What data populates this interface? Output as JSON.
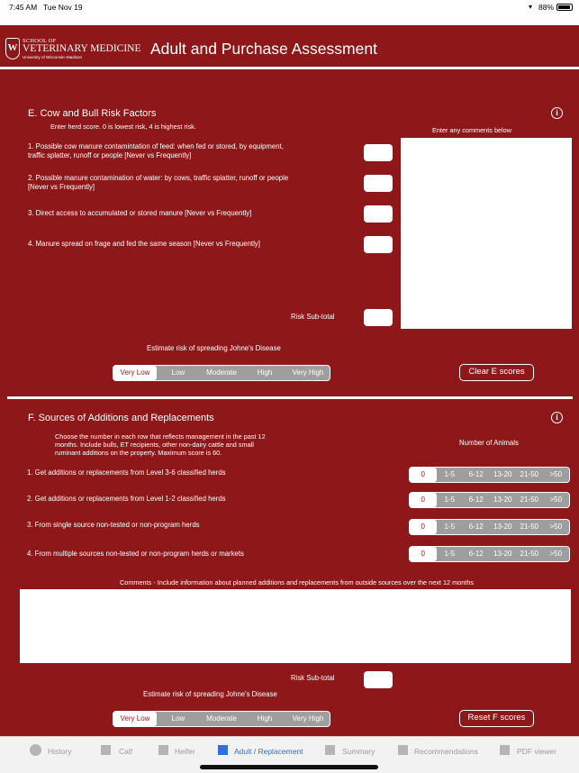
{
  "status_bar": {
    "time": "7:45 AM",
    "date": "Tue Nov 19",
    "battery": "88%"
  },
  "header": {
    "logo": {
      "line1": "SCHOOL OF",
      "line2": "VETERINARY MEDICINE",
      "line3": "University of Wisconsin–Madison"
    },
    "title": "Adult and Purchase Assessment"
  },
  "section_e": {
    "title": "E. Cow and Bull Risk Factors",
    "instructions": "Enter herd score. 0 is lowest risk, 4 is highest risk.",
    "comments_label": "Enter any comments below",
    "questions": [
      "1. Possible cow manure contamintation of feed: when fed or stored, by equipment, traffic splatter, runoff or people [Never vs Frequently]",
      "2. Possible manure contamination of water: by cows, traffic splatter, runoff or people [Never vs Frequently]",
      "3. Direct access to accumulated or stored manure [Never vs Frequently]",
      "4. Manure spread on frage and fed the same season [Never vs Frequently]"
    ],
    "subtotal_label": "Risk Sub-total",
    "estimate_label": "Estimate risk of spreading Johne's Disease",
    "risk_options": [
      "Very Low",
      "Low",
      "Moderate",
      "High",
      "Very High"
    ],
    "risk_selected": "Very Low",
    "clear_button": "Clear E scores"
  },
  "section_f": {
    "title": "F. Sources of Additions and Replacements",
    "instructions": "Choose the number in each row that reflects management in the past 12 months. Include bulls, ET recipients, other non-dairy cattle and small ruminant additions on the property. Maximum score is 60.",
    "animals_header": "Number of Animals",
    "count_options": [
      "0",
      "1-5",
      "6-12",
      "13-20",
      "21-50",
      ">50"
    ],
    "rows": [
      {
        "label": "1. Get additions or replacements from Level 3-6 classified herds",
        "selected": "0"
      },
      {
        "label": "2. Get additions or replacements from Level 1-2 classified herds",
        "selected": "0"
      },
      {
        "label": "3. From single source non-tested or non-program herds",
        "selected": "0"
      },
      {
        "label": "4. From multiple sources non-tested or non-program herds or markets",
        "selected": "0"
      }
    ],
    "comments_label": "Comments - Include information about planned additions and replacements from outside sources over the next 12 months",
    "subtotal_label": "Risk Sub-total",
    "estimate_label": "Estimate risk of spreading Johne's Disease",
    "risk_options": [
      "Very Low",
      "Low",
      "Moderate",
      "High",
      "Very High"
    ],
    "risk_selected": "Very Low",
    "reset_button": "Reset F scores"
  },
  "tab_bar": {
    "items": [
      {
        "label": "History",
        "icon": "circle-icon",
        "active": false
      },
      {
        "label": "Calf",
        "icon": "square-icon",
        "active": false
      },
      {
        "label": "Heifer",
        "icon": "square-icon",
        "active": false
      },
      {
        "label": "Adult / Replacement",
        "icon": "square-icon",
        "active": true
      },
      {
        "label": "Summary",
        "icon": "square-icon",
        "active": false
      },
      {
        "label": "Recommendations",
        "icon": "square-icon",
        "active": false
      },
      {
        "label": "PDF viewer",
        "icon": "square-icon",
        "active": false
      }
    ]
  },
  "colors": {
    "background": "#8e1719",
    "selected_text": "#b0161d",
    "active_tab": "#2f6fe0",
    "segment_bg": "#9e9e9e"
  }
}
